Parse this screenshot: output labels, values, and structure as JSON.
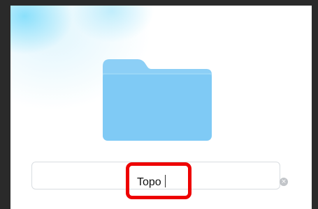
{
  "folder": {
    "icon": "folder-icon",
    "colors": {
      "tab": "#8ccff6",
      "body": "#7fcaf5"
    }
  },
  "name_field": {
    "value": "Topo",
    "clear_icon": "clear-icon",
    "clear_glyph": "×"
  },
  "highlight_color": "#ee0000"
}
